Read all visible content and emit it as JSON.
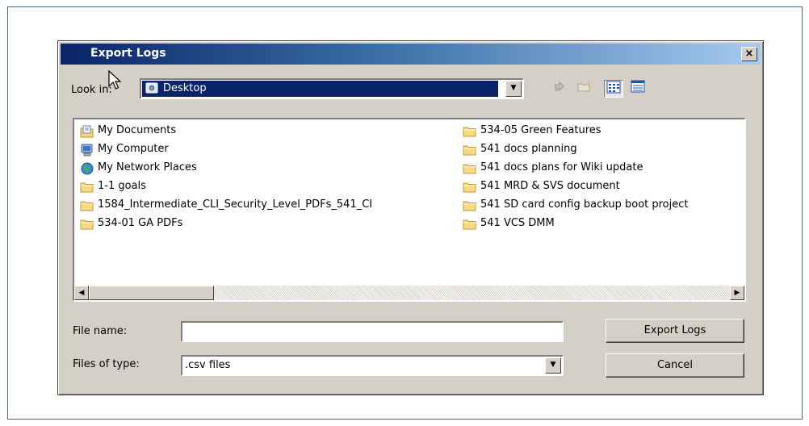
{
  "dialog": {
    "title": "Export Logs",
    "close_label": "×"
  },
  "lookin": {
    "label": "Look in:",
    "value": "Desktop"
  },
  "files": {
    "column1": [
      {
        "label": "My Documents",
        "icon": "my-documents-icon"
      },
      {
        "label": "My Computer",
        "icon": "my-computer-icon"
      },
      {
        "label": "My Network Places",
        "icon": "network-places-icon"
      },
      {
        "label": "1-1 goals",
        "icon": "folder-icon"
      },
      {
        "label": "1584_Intermediate_CLI_Security_Level_PDFs_541_CI",
        "icon": "folder-icon"
      },
      {
        "label": "534-01 GA PDFs",
        "icon": "folder-icon"
      }
    ],
    "column2": [
      {
        "label": "534-05 Green Features",
        "icon": "folder-icon"
      },
      {
        "label": "541 docs planning",
        "icon": "folder-icon"
      },
      {
        "label": "541 docs plans for Wiki update",
        "icon": "folder-icon"
      },
      {
        "label": "541 MRD & SVS document",
        "icon": "folder-icon"
      },
      {
        "label": "541 SD card config backup boot project",
        "icon": "folder-icon"
      },
      {
        "label": "541 VCS DMM",
        "icon": "folder-icon"
      }
    ]
  },
  "filename": {
    "label": "File name:",
    "value": ""
  },
  "filetype": {
    "label": "Files of type:",
    "value": ".csv files"
  },
  "buttons": {
    "export": "Export Logs",
    "cancel": "Cancel"
  }
}
